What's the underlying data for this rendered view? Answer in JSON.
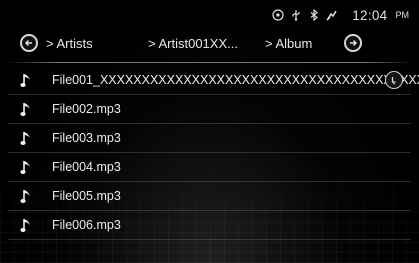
{
  "status": {
    "time": "12:04",
    "ampm": "PM",
    "icons": [
      "disc-icon",
      "usb-icon",
      "bluetooth-icon",
      "phone-signal-icon"
    ]
  },
  "nav": {
    "back_icon": "left-arrow-circle-icon",
    "forward_icon": "right-arrow-circle-icon",
    "crumbs": [
      "> Artists",
      "> Artist001XX...",
      "> Album"
    ]
  },
  "files": [
    {
      "name": "File001_XXXXXXXXXXXXXXXXXXXXXXXXXXXXXXXXXXXXXXXXXX›",
      "icon": "music-note-icon"
    },
    {
      "name": "File002.mp3",
      "icon": "music-note-icon"
    },
    {
      "name": "File003.mp3",
      "icon": "music-note-icon"
    },
    {
      "name": "File004.mp3",
      "icon": "music-note-icon"
    },
    {
      "name": "File005.mp3",
      "icon": "music-note-icon"
    },
    {
      "name": "File006.mp3",
      "icon": "music-note-icon"
    }
  ],
  "colors": {
    "background": "#000000",
    "text": "#e8e8e8"
  }
}
